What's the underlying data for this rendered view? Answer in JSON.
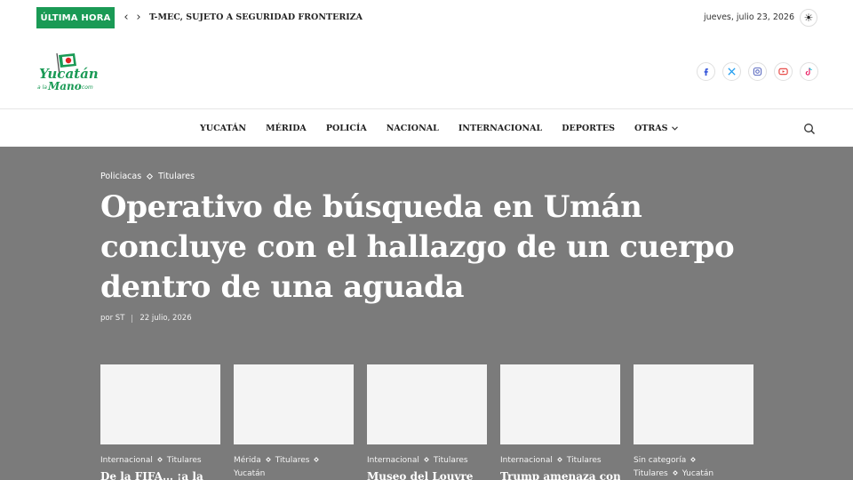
{
  "topbar": {
    "breaking_label": "ÚLTIMA HORA",
    "ticker_text": "T-MEC, SUJETO A SEGURIDAD FRONTERIZA Y TRATADOS",
    "date": "jueves, julio 23, 2026"
  },
  "header": {
    "logo_text": "Yucatán a la Mano .com",
    "socials": [
      "facebook-icon",
      "x-icon",
      "instagram-icon",
      "youtube-icon",
      "tiktok-icon"
    ]
  },
  "nav": {
    "items": [
      "YUCATÁN",
      "MÉRIDA",
      "POLICÍA",
      "NACIONAL",
      "INTERNACIONAL",
      "DEPORTES",
      "OTRAS"
    ]
  },
  "hero": {
    "categories": [
      "Policiacas",
      "Titulares"
    ],
    "headline": "Operativo de búsqueda en Umán concluye con el hallazgo de un cuerpo dentro de una aguada",
    "author": "por ST",
    "date": "22 julio, 2026"
  },
  "cards": [
    {
      "cats": [
        "Internacional",
        "Titulares"
      ],
      "title": "De la FIFA… ¡a la"
    },
    {
      "cats": [
        "Mérida",
        "Titulares",
        "Yucatán"
      ],
      "title": ""
    },
    {
      "cats": [
        "Internacional",
        "Titulares"
      ],
      "title": "Museo del Louvre"
    },
    {
      "cats": [
        "Internacional",
        "Titulares"
      ],
      "title": "Trump amenaza con"
    },
    {
      "cats": [
        "Sin categoría",
        "Titulares",
        "Yucatán"
      ],
      "title": ""
    }
  ],
  "colors": {
    "accent": "#1a9a55",
    "hero_bg": "#7b7b7b"
  }
}
